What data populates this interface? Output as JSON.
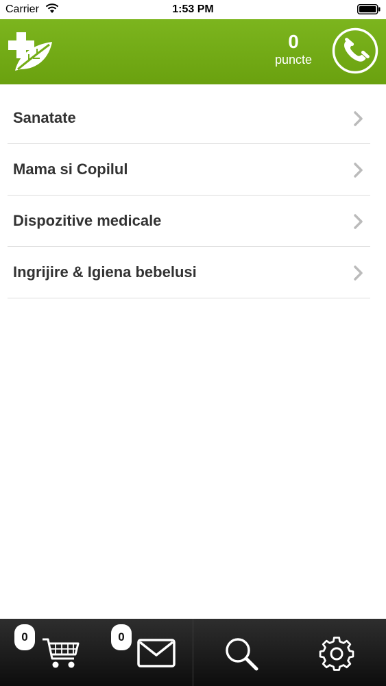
{
  "status_bar": {
    "carrier": "Carrier",
    "time": "1:53 PM",
    "icons": [
      "wifi-icon",
      "battery-icon"
    ]
  },
  "header": {
    "logo_icon": "cross-leaf-logo-icon",
    "points_value": "0",
    "points_label": "puncte",
    "call_icon": "phone-icon",
    "brand_color": "#74ad17"
  },
  "categories": [
    {
      "label": "Sanatate"
    },
    {
      "label": "Mama si Copilul"
    },
    {
      "label": "Dispozitive medicale"
    },
    {
      "label": "Ingrijire & Igiena bebelusi"
    }
  ],
  "tab_bar": {
    "cart_badge": "0",
    "mail_badge": "0",
    "icons": [
      "cart-icon",
      "mail-icon",
      "search-icon",
      "gear-icon"
    ]
  }
}
